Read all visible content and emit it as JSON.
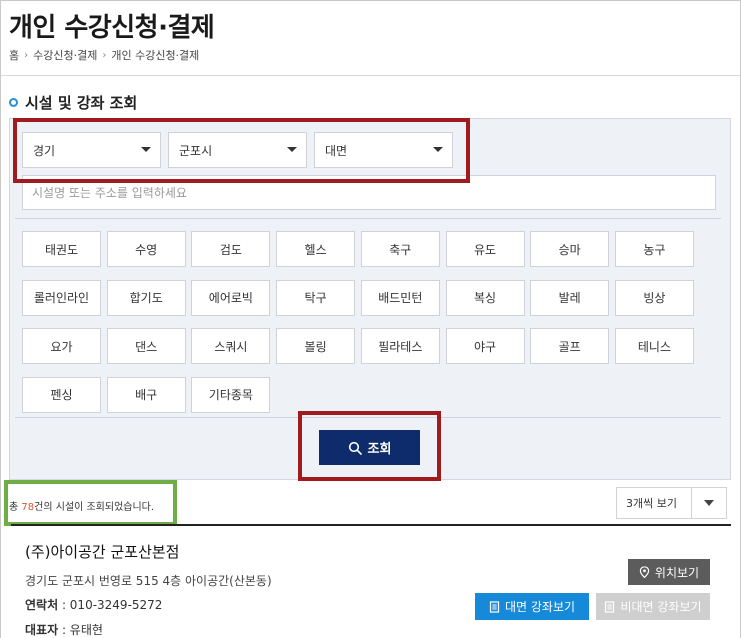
{
  "page": {
    "title": "개인 수강신청·결제",
    "breadcrumb": [
      "홈",
      "수강신청·결제",
      "개인 수강신청·결제"
    ]
  },
  "section": {
    "title": "시설 및 강좌 조회"
  },
  "filters": {
    "region": "경기",
    "city": "군포시",
    "mode": "대면",
    "address_placeholder": "시설명 또는 주소를 입력하세요"
  },
  "sports": [
    "태권도",
    "수영",
    "검도",
    "헬스",
    "축구",
    "유도",
    "승마",
    "농구",
    "롤러인라인",
    "합기도",
    "에어로빅",
    "탁구",
    "배드민턴",
    "복싱",
    "발레",
    "빙상",
    "요가",
    "댄스",
    "스쿼시",
    "볼링",
    "필라테스",
    "야구",
    "골프",
    "테니스",
    "펜싱",
    "배구",
    "기타종목"
  ],
  "search_button": {
    "label": "조회",
    "icon": "search-icon"
  },
  "results": {
    "prefix": "총 ",
    "count": "78",
    "suffix": "건의 시설이 조회되었습니다.",
    "view_option": "3개씩 보기"
  },
  "facility": {
    "name": "(주)아이공간 군포산본점",
    "address": "경기도 군포시 번영로 515 4층 아이공간(산본동)",
    "contact_label": "연락처",
    "contact_value": " : 010-3249-5272",
    "rep_label": "대표자",
    "rep_value": " : 유태현",
    "location_button": "위치보기",
    "offline_button": "대면 강좌보기",
    "online_button": "비대면 강좌보기"
  },
  "colors": {
    "navy": "#0e2c6b",
    "blue": "#1689d8",
    "highlight_red": "#a11a1e",
    "highlight_green": "#6fae47",
    "count_orange": "#e0562d"
  }
}
